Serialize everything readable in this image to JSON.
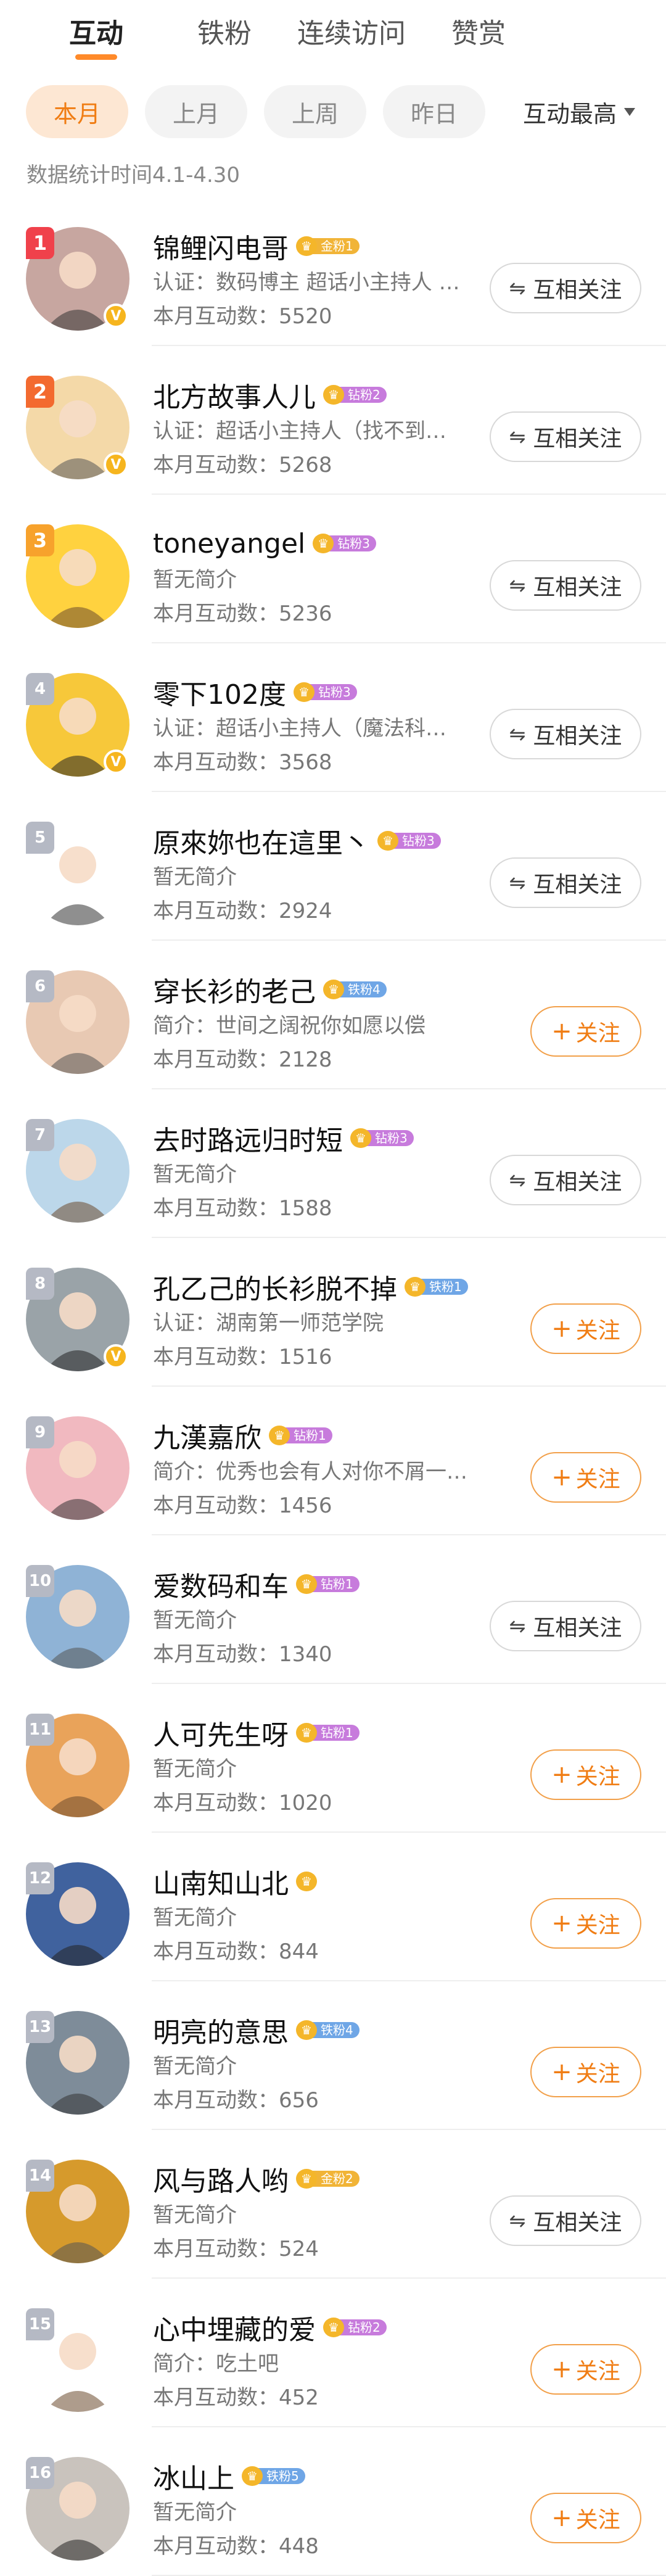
{
  "tabs": [
    "互动",
    "铁粉",
    "连续访问",
    "赞赏"
  ],
  "filters": [
    "本月",
    "上月",
    "上周",
    "昨日"
  ],
  "sort_label": "互动最高",
  "stat_note": "数据统计时间4.1-4.30",
  "colors": {
    "accent": "#f07d14",
    "tab_indicator": "#ff8a2a"
  },
  "buttons": {
    "mutual": "互相关注",
    "follow": "关注"
  },
  "icons": {
    "mutual": "swap-arrows-icon",
    "follow": "plus-icon",
    "verified": "verified-v-icon",
    "fan_badge": "heart-crown-icon"
  },
  "users": [
    {
      "rank": "1",
      "name": "锦鲤闪电哥",
      "badge": "金粉1",
      "badge_type": "gold",
      "desc": "认证：数码博主 超话小主持人 …",
      "count": "本月互动数：5520",
      "relation": "mutual",
      "verified": true,
      "avatar_color": "#c7a6a0"
    },
    {
      "rank": "2",
      "name": "北方故事人儿",
      "badge": "钻粉2",
      "badge_type": "drill",
      "desc": "认证：超话小主持人（找不到…",
      "count": "本月互动数：5268",
      "relation": "mutual",
      "verified": true,
      "avatar_color": "#f4d9a8"
    },
    {
      "rank": "3",
      "name": "toneyangel",
      "badge": "钻粉3",
      "badge_type": "drill",
      "desc": "暂无简介",
      "count": "本月互动数：5236",
      "relation": "mutual",
      "verified": false,
      "avatar_color": "#ffd23f"
    },
    {
      "rank": "4",
      "name": "零下102度",
      "badge": "钻粉3",
      "badge_type": "drill",
      "desc": "认证：超话小主持人（魔法科…",
      "count": "本月互动数：3568",
      "relation": "mutual",
      "verified": true,
      "avatar_color": "#f7c83a"
    },
    {
      "rank": "5",
      "name": "原來妳也在這里丶",
      "badge": "钻粉3",
      "badge_type": "drill",
      "desc": "暂无简介",
      "count": "本月互动数：2924",
      "relation": "mutual",
      "verified": false,
      "avatar_color": "#ffffff"
    },
    {
      "rank": "6",
      "name": "穿长衫的老己",
      "badge": "铁粉4",
      "badge_type": "iron",
      "desc": "简介：世间之阔祝你如愿以偿",
      "count": "本月互动数：2128",
      "relation": "follow",
      "verified": false,
      "avatar_color": "#e8c9b3"
    },
    {
      "rank": "7",
      "name": "去时路远归时短",
      "badge": "钻粉3",
      "badge_type": "drill",
      "desc": "暂无简介",
      "count": "本月互动数：1588",
      "relation": "mutual",
      "verified": false,
      "avatar_color": "#bcd7ea"
    },
    {
      "rank": "8",
      "name": "孔乙己的长衫脱不掉",
      "badge": "铁粉1",
      "badge_type": "iron",
      "desc": "认证：湖南第一师范学院",
      "count": "本月互动数：1516",
      "relation": "follow",
      "verified": true,
      "avatar_color": "#9aa3a8"
    },
    {
      "rank": "9",
      "name": "九漢嘉欣",
      "badge": "钻粉1",
      "badge_type": "drill",
      "desc": "简介：优秀也会有人对你不屑一…",
      "count": "本月互动数：1456",
      "relation": "follow",
      "verified": false,
      "avatar_color": "#f1b9c0"
    },
    {
      "rank": "10",
      "name": "爱数码和车",
      "badge": "钻粉1",
      "badge_type": "drill",
      "desc": "暂无简介",
      "count": "本月互动数：1340",
      "relation": "mutual",
      "verified": false,
      "avatar_color": "#8fb3d6"
    },
    {
      "rank": "11",
      "name": "人可先生呀",
      "badge": "钻粉1",
      "badge_type": "drill",
      "desc": "暂无简介",
      "count": "本月互动数：1020",
      "relation": "follow",
      "verified": false,
      "avatar_color": "#e9a35a"
    },
    {
      "rank": "12",
      "name": "山南知山北",
      "badge": "",
      "badge_type": "",
      "desc": "暂无简介",
      "count": "本月互动数：844",
      "relation": "follow",
      "verified": false,
      "avatar_color": "#40629e"
    },
    {
      "rank": "13",
      "name": "明亮的意思",
      "badge": "铁粉4",
      "badge_type": "iron",
      "desc": "暂无简介",
      "count": "本月互动数：656",
      "relation": "follow",
      "verified": false,
      "avatar_color": "#7e8c99"
    },
    {
      "rank": "14",
      "name": "风与路人哟",
      "badge": "金粉2",
      "badge_type": "gold",
      "desc": "暂无简介",
      "count": "本月互动数：524",
      "relation": "mutual",
      "verified": false,
      "avatar_color": "#d69a2c"
    },
    {
      "rank": "15",
      "name": "心中埋藏的爱",
      "badge": "钻粉2",
      "badge_type": "drill",
      "desc": "简介：吃土吧",
      "count": "本月互动数：452",
      "relation": "follow",
      "verified": false,
      "avatar_color": "#ffffff"
    },
    {
      "rank": "16",
      "name": "冰山上",
      "badge": "铁粉5",
      "badge_type": "iron",
      "desc": "暂无简介",
      "count": "本月互动数：448",
      "relation": "follow",
      "verified": false,
      "avatar_color": "#c9c3bd"
    }
  ]
}
